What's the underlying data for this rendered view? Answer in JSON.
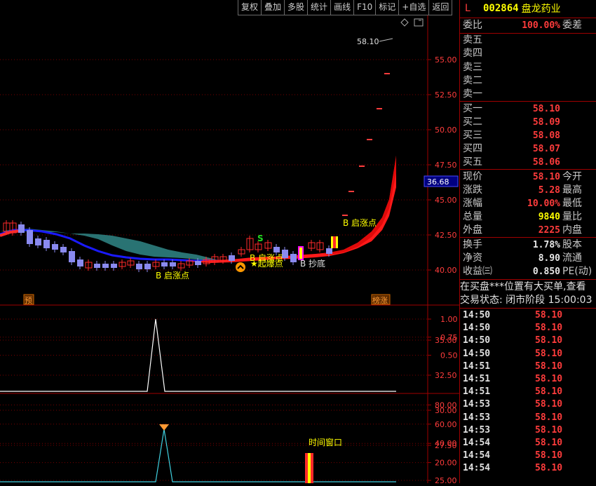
{
  "toolbar": [
    "复权",
    "叠加",
    "多股",
    "统计",
    "画线",
    "F10",
    "标记",
    "+自选",
    "返回"
  ],
  "chart": {
    "main_axis": [
      "55.00",
      "52.50",
      "50.00",
      "47.50",
      "45.00",
      "42.50",
      "40.00",
      "35.00",
      "32.50",
      "30.00",
      "27.50",
      "25.00"
    ],
    "current_price_tag": "36.68",
    "peak_price_label": "58.10",
    "annotations": [
      "B 启涨点",
      "B 启涨点",
      "B 启涨点",
      "★起爆点",
      "B 抄底",
      "S"
    ],
    "bottom_tags": [
      "预",
      "榜涨"
    ],
    "ind1_axis": [
      "1.00",
      "0.75",
      "0.50"
    ],
    "ind2_axis": [
      "80.00",
      "60.00",
      "40.00",
      "20.00"
    ],
    "ind2_label": "时间窗口",
    "colors": {
      "up": "#ff2a2a",
      "down": "#8a8af0",
      "ma_blue": "#1a1aff",
      "fill_teal": "#2a8080",
      "accent_yellow": "#ffff00"
    }
  },
  "panel": {
    "badge": "L",
    "code": "002864",
    "name": "盘龙药业",
    "weibi": {
      "label": "委比",
      "value": "100.00%",
      "label2": "委差"
    },
    "sells": [
      "卖五",
      "卖四",
      "卖三",
      "卖二",
      "卖一"
    ],
    "buys": [
      {
        "label": "买一",
        "price": "58.10"
      },
      {
        "label": "买二",
        "price": "58.09"
      },
      {
        "label": "买三",
        "price": "58.08"
      },
      {
        "label": "买四",
        "price": "58.07"
      },
      {
        "label": "买五",
        "price": "58.06"
      }
    ],
    "quote": [
      {
        "label": "现价",
        "value": "58.10",
        "color": "red",
        "label2": "今开"
      },
      {
        "label": "涨跌",
        "value": "5.28",
        "color": "red",
        "label2": "最高"
      },
      {
        "label": "涨幅",
        "value": "10.00%",
        "color": "red",
        "label2": "最低"
      },
      {
        "label": "总量",
        "value": "9840",
        "color": "yellow",
        "label2": "量比"
      },
      {
        "label": "外盘",
        "value": "2225",
        "color": "red",
        "label2": "内盘"
      }
    ],
    "stats": [
      {
        "label": "换手",
        "value": "1.78%",
        "label2": "股本"
      },
      {
        "label": "净资",
        "value": "8.90",
        "label2": "流通"
      },
      {
        "label": "收益㈢",
        "value": "0.850",
        "label2": "PE(动)"
      }
    ],
    "notice": "在买盘***位置有大买单,查看",
    "status": "交易状态: 闭市阶段 15:00:03",
    "ticks": [
      {
        "time": "14:50",
        "price": "58.10"
      },
      {
        "time": "14:50",
        "price": "58.10"
      },
      {
        "time": "14:50",
        "price": "58.10"
      },
      {
        "time": "14:50",
        "price": "58.10"
      },
      {
        "time": "14:51",
        "price": "58.10"
      },
      {
        "time": "14:51",
        "price": "58.10"
      },
      {
        "time": "14:51",
        "price": "58.10"
      },
      {
        "time": "14:53",
        "price": "58.10"
      },
      {
        "time": "14:53",
        "price": "58.10"
      },
      {
        "time": "14:53",
        "price": "58.10"
      },
      {
        "time": "14:54",
        "price": "58.10"
      },
      {
        "time": "14:54",
        "price": "58.10"
      },
      {
        "time": "14:54",
        "price": "58.10"
      }
    ]
  }
}
